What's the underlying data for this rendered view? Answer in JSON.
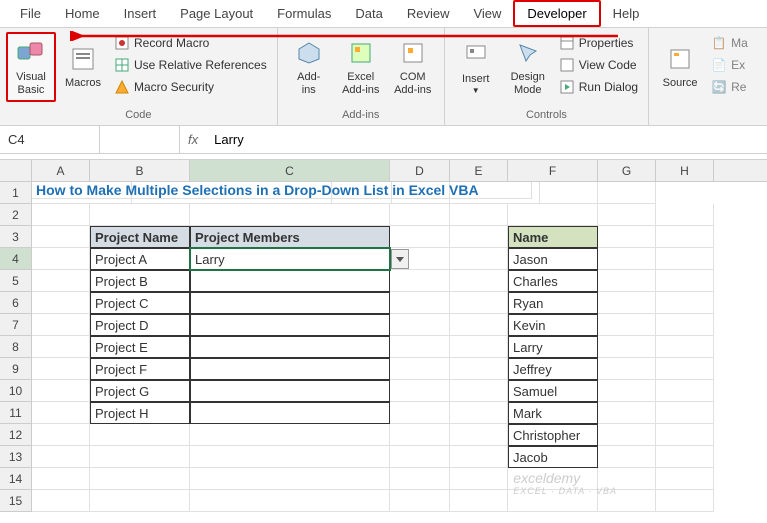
{
  "menu": {
    "items": [
      "File",
      "Home",
      "Insert",
      "Page Layout",
      "Formulas",
      "Data",
      "Review",
      "View",
      "Developer",
      "Help"
    ],
    "active": "Developer"
  },
  "ribbon": {
    "code": {
      "label": "Code",
      "visual_basic": "Visual\nBasic",
      "macros": "Macros",
      "record_macro": "Record Macro",
      "use_relative": "Use Relative References",
      "macro_security": "Macro Security"
    },
    "addins": {
      "label": "Add-ins",
      "addins": "Add-\nins",
      "excel_addins": "Excel\nAdd-ins",
      "com_addins": "COM\nAdd-ins"
    },
    "controls": {
      "label": "Controls",
      "insert": "Insert",
      "design_mode": "Design\nMode",
      "properties": "Properties",
      "view_code": "View Code",
      "run_dialog": "Run Dialog"
    },
    "xml": {
      "source": "Source",
      "map": "Ma",
      "exp": "Ex",
      "re": "Re"
    }
  },
  "formula_bar": {
    "name_box": "C4",
    "fx": "fx",
    "value": "Larry"
  },
  "columns": [
    "A",
    "B",
    "C",
    "D",
    "E",
    "F",
    "G",
    "H"
  ],
  "title": "How to Make Multiple Selections in a Drop-Down List in Excel VBA",
  "table1": {
    "headers": [
      "Project Name",
      "Project Members"
    ],
    "rows": [
      [
        "Project A",
        "Larry"
      ],
      [
        "Project B",
        ""
      ],
      [
        "Project C",
        ""
      ],
      [
        "Project D",
        ""
      ],
      [
        "Project E",
        ""
      ],
      [
        "Project F",
        ""
      ],
      [
        "Project G",
        ""
      ],
      [
        "Project H",
        ""
      ]
    ]
  },
  "table2": {
    "header": "Name",
    "rows": [
      "Jason",
      "Charles",
      "Ryan",
      "Kevin",
      "Larry",
      "Jeffrey",
      "Samuel",
      "Mark",
      "Christopher",
      "Jacob"
    ]
  },
  "watermark": {
    "main": "exceldemy",
    "sub": "EXCEL · DATA · VBA"
  }
}
